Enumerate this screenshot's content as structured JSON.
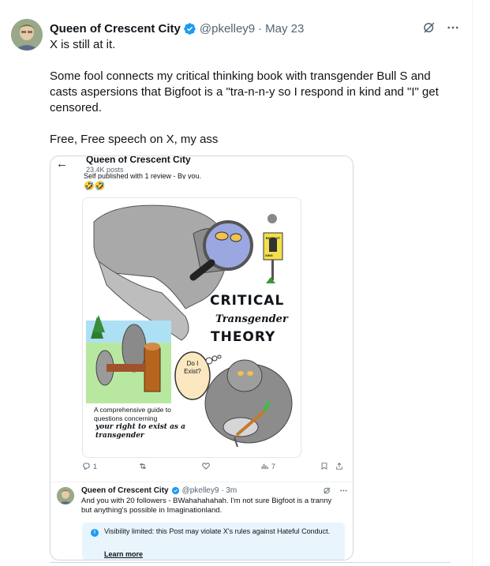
{
  "tweet": {
    "author_name": "Queen of Crescent City",
    "handle": "@pkelley9",
    "separator": "·",
    "date": "May 23",
    "text": [
      "X is still at it.",
      "Some fool connects my critical thinking book with transgender Bull S and casts aspersions that Bigfoot is a \"tra-n-n-y so I respond in kind and \"I\" get censored.",
      "Free, Free speech on X, my ass"
    ]
  },
  "screenshot": {
    "profile_name": "Queen of Crescent City",
    "post_count": "23.4K posts",
    "prev_text": "Self published with 1 review - By you.",
    "emoji": "🤣🤣",
    "book": {
      "line1": "CRITICAL",
      "line2": "Transgender",
      "line3": "THEORY",
      "guide": "A comprehensive guide to questions concerning",
      "tagline": "your right to exist as a transgender",
      "bubble": "Do I Exist?",
      "sign_top": "BIGFOOT",
      "sign_bottom": "XING"
    },
    "actions": {
      "replies": "1",
      "views": "7"
    },
    "reply": {
      "author_name": "Queen of Crescent City",
      "handle": "@pkelley9 · 3m",
      "text": "And you with 20 followers - BWahahahahah.  I'm not sure Bigfoot is a tranny but anything's possible in Imaginationland."
    },
    "notice": {
      "text": "Visibility limited: this Post may violate X's rules against Hateful Conduct.",
      "link": "Learn more"
    }
  },
  "colors": {
    "verified": "#1d9bf0",
    "secondary_text": "#536471",
    "notice_bg": "#e8f5fd"
  }
}
